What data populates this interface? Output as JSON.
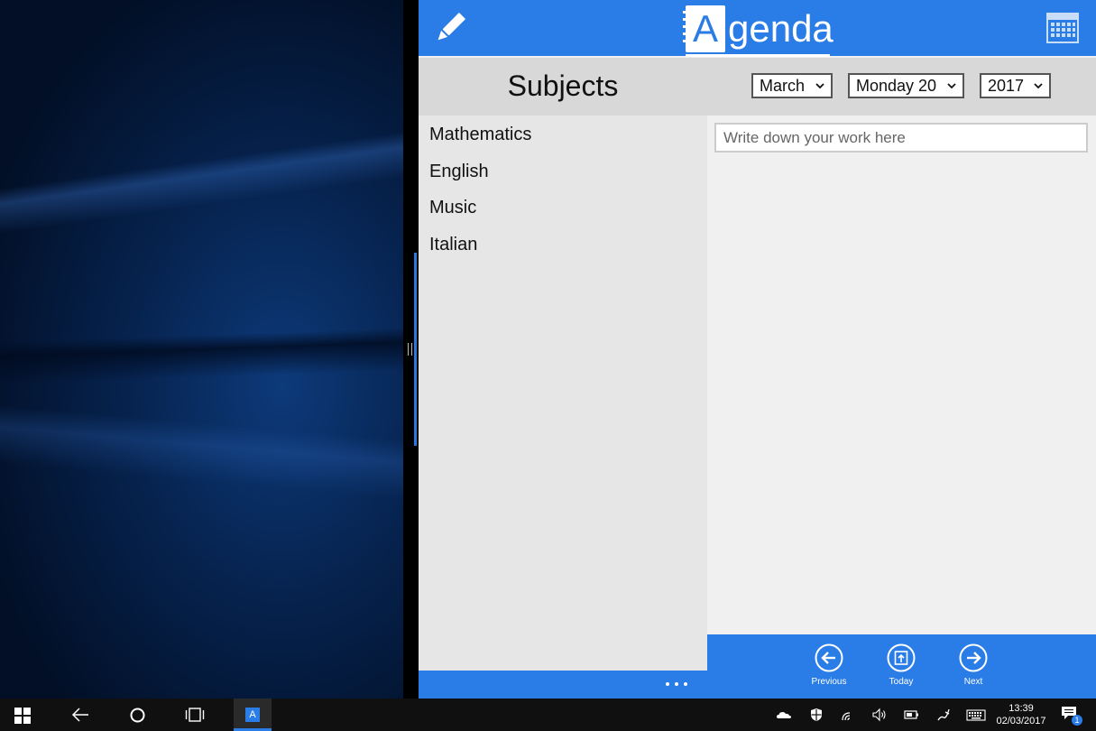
{
  "app": {
    "logo_letter": "A",
    "logo_text": "genda"
  },
  "toolbar": {
    "subjects_title": "Subjects",
    "month": "March",
    "day": "Monday 20",
    "year": "2017"
  },
  "subjects": [
    "Mathematics",
    "English",
    "Music",
    "Italian"
  ],
  "work": {
    "placeholder": "Write down your work here"
  },
  "nav": {
    "previous_label": "Previous",
    "today_label": "Today",
    "next_label": "Next"
  },
  "taskbar": {
    "app_icon_letter": "A",
    "time": "13:39",
    "date": "02/03/2017",
    "notification_count": "1"
  },
  "icons": {
    "header_left": "pencil-icon",
    "header_right": "calendar-icon",
    "nav": [
      "arrow-left-circle-icon",
      "today-circle-icon",
      "arrow-right-circle-icon"
    ],
    "more": "more-dots-icon"
  },
  "colors": {
    "accent": "#2a7ce6",
    "toolbar_bg": "#d8d8d8",
    "subjects_bg": "#e6e6e6",
    "taskbar_bg": "#101010"
  }
}
